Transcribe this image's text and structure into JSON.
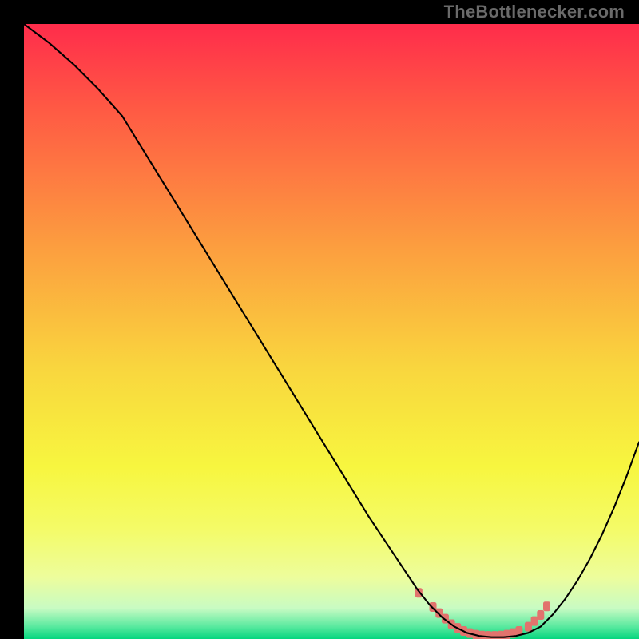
{
  "watermark": "TheBottlenecker.com",
  "chart_data": {
    "type": "line",
    "title": "",
    "xlabel": "",
    "ylabel": "",
    "xlim": [
      0,
      100
    ],
    "ylim": [
      0,
      100
    ],
    "grid": false,
    "background_gradient": {
      "stops": [
        {
          "pct": 0,
          "color": "#ff2c4b"
        },
        {
          "pct": 14,
          "color": "#ff5a44"
        },
        {
          "pct": 36,
          "color": "#fc9d3f"
        },
        {
          "pct": 56,
          "color": "#f9d63e"
        },
        {
          "pct": 72,
          "color": "#f7f63f"
        },
        {
          "pct": 82,
          "color": "#f4fb67"
        },
        {
          "pct": 90,
          "color": "#edfd9c"
        },
        {
          "pct": 95,
          "color": "#c8fbc3"
        },
        {
          "pct": 98,
          "color": "#59e99f"
        },
        {
          "pct": 100,
          "color": "#05d67e"
        }
      ]
    },
    "series": [
      {
        "name": "curve",
        "color": "#000000",
        "stroke_width": 2.1,
        "x": [
          0,
          4,
          8,
          12,
          16,
          20,
          24,
          28,
          32,
          36,
          40,
          44,
          48,
          52,
          56,
          60,
          64,
          66,
          68,
          70,
          72,
          74,
          76,
          78,
          80,
          82,
          84,
          86,
          88,
          90,
          92,
          94,
          96,
          98,
          100
        ],
        "y": [
          100,
          97,
          93.5,
          89.5,
          85,
          78.5,
          72,
          65.5,
          59,
          52.5,
          46,
          39.5,
          33,
          26.5,
          20,
          14,
          8,
          5.5,
          3.5,
          2,
          1,
          0.5,
          0.3,
          0.3,
          0.5,
          1,
          2,
          4,
          6.5,
          9.5,
          13,
          17,
          21.5,
          26.5,
          32
        ]
      },
      {
        "name": "marker-band",
        "color": "#e2736d",
        "type": "scatter",
        "marker_size": 10,
        "x": [
          64.2,
          66.5,
          67.5,
          68.5,
          69.5,
          70.5,
          71.5,
          72.5,
          73.5,
          74.5,
          75.5,
          76.5,
          77.5,
          78.5,
          79.5,
          80.5,
          82.0,
          83.0,
          84.0,
          85.0
        ],
        "y": [
          7.5,
          5.2,
          4.2,
          3.3,
          2.4,
          1.8,
          1.3,
          0.95,
          0.7,
          0.55,
          0.5,
          0.5,
          0.55,
          0.7,
          0.95,
          1.3,
          2.0,
          2.9,
          3.9,
          5.3
        ]
      }
    ]
  }
}
